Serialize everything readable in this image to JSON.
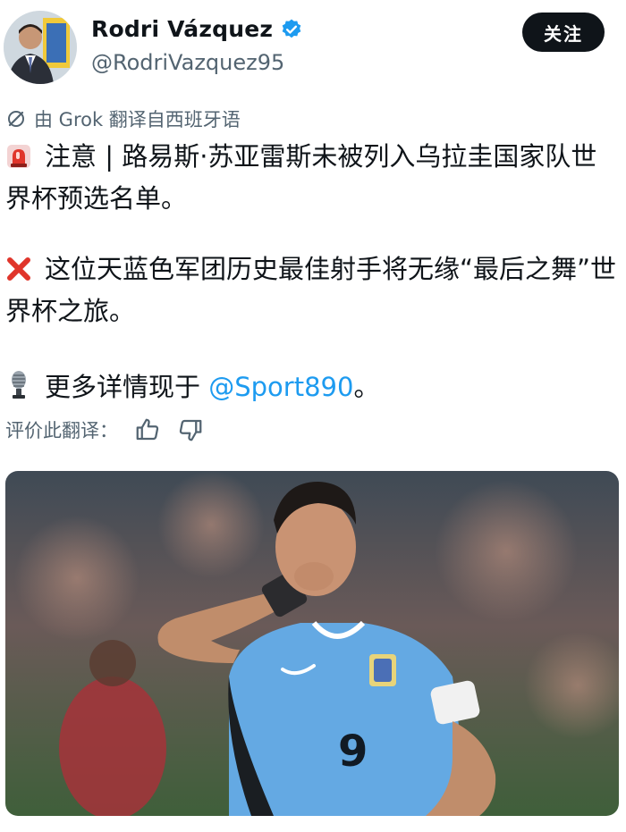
{
  "author": {
    "display_name": "Rodri Vázquez",
    "handle": "@RodriVazquez95",
    "verified": true,
    "avatar_icon": "profile-photo"
  },
  "follow_button": {
    "label": "关注"
  },
  "translation_notice": {
    "icon": "grok-icon",
    "text": "由 Grok 翻译自西班牙语"
  },
  "post": {
    "paragraphs": [
      {
        "icon": "siren-icon",
        "text": "注意 | 路易斯·苏亚雷斯未被列入乌拉圭国家队世界杯预选名单。"
      },
      {
        "icon": "cross-mark-icon",
        "text": "这位天蓝色军团历史最佳射手将无缘“最后之舞”世界杯之旅。"
      },
      {
        "icon": "microphone-icon",
        "text_before": "更多详情现于 ",
        "mention": "@Sport890",
        "text_after": "。"
      }
    ]
  },
  "rating": {
    "label": "评价此翻译：",
    "thumbs_up_icon": "thumbs-up-icon",
    "thumbs_down_icon": "thumbs-down-icon"
  },
  "media": {
    "alt": "Luis Suárez in Uruguay sky-blue jersey celebrating, number 9",
    "jersey_number": "9",
    "colors": {
      "jersey": "#64a9e3",
      "background_green": "#4a6a3e"
    }
  },
  "colors": {
    "accent": "#1d9bf0",
    "text": "#0f1419",
    "secondary": "#536471",
    "cross": "#e0352b"
  }
}
